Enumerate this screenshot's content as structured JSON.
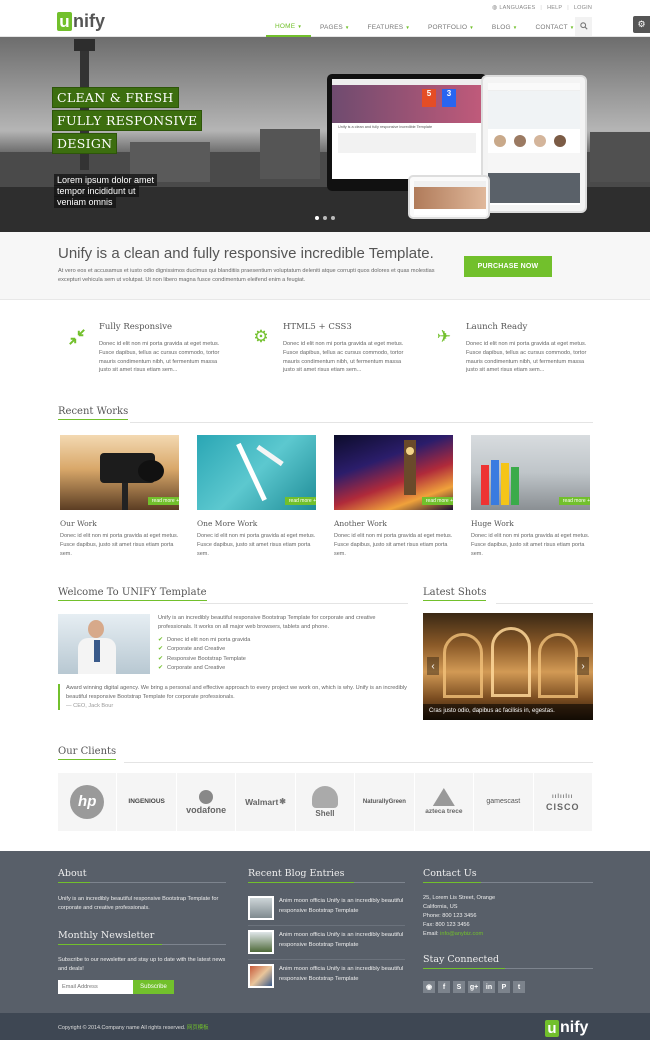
{
  "brand": {
    "logo_u": "u",
    "logo_rest": "nify",
    "accent": "#72c02c"
  },
  "topbar": {
    "languages": "LANGUAGES",
    "help": "HELP",
    "login": "LOGIN"
  },
  "nav": {
    "items": [
      {
        "label": "HOME"
      },
      {
        "label": "PAGES"
      },
      {
        "label": "FEATURES"
      },
      {
        "label": "PORTFOLIO"
      },
      {
        "label": "BLOG"
      },
      {
        "label": "CONTACT"
      }
    ],
    "active": "HOME"
  },
  "hero": {
    "captions": [
      "CLEAN & FRESH",
      "FULLY RESPONSIVE",
      "DESIGN"
    ],
    "sub": [
      "Lorem ipsum dolor amet",
      "tempor incididunt ut",
      "veniam omnis"
    ],
    "slides": 3,
    "active_slide": 1,
    "mock_title": "Unify is a clean and fully responsive incredible Template"
  },
  "purchase": {
    "title": "Unify is a clean and fully responsive incredible Template.",
    "text": "At vero eos et accusamus et iusto odio dignissimos ducimus qui blanditiis praesentium voluptatum deleniti atque corrupti quos dolores et quas molestias excepturi vehicula sem ut volutpat. Ut non libero magna fusce condimentum eleifend enim a feugiat.",
    "button": "PURCHASE NOW"
  },
  "features": [
    {
      "title": "Fully Responsive",
      "text": "Donec id elit non mi porta gravida at eget metus. Fusce dapibus, tellus ac cursus commodo, tortor mauris condimentum nibh, ut fermentum massa justo sit amet risus etiam sem..."
    },
    {
      "title": "HTML5 + CSS3",
      "text": "Donec id elit non mi porta gravida at eget metus. Fusce dapibus, tellus ac cursus commodo, tortor mauris condimentum nibh, ut fermentum massa justo sit amet risus etiam sem..."
    },
    {
      "title": "Launch Ready",
      "text": "Donec id elit non mi porta gravida at eget metus. Fusce dapibus, tellus ac cursus commodo, tortor mauris condimentum nibh, ut fermentum massa justo sit amet risus etiam sem..."
    }
  ],
  "recent_works": {
    "heading": "Recent Works",
    "read_more": "read more +",
    "items": [
      {
        "title": "Our Work",
        "text": "Donec id elit non mi porta gravida at eget metus. Fusce dapibus, justo sit amet risus etiam porta sem."
      },
      {
        "title": "One More Work",
        "text": "Donec id elit non mi porta gravida at eget metus. Fusce dapibus, justo sit amet risus etiam porta sem."
      },
      {
        "title": "Another Work",
        "text": "Donec id elit non mi porta gravida at eget metus. Fusce dapibus, justo sit amet risus etiam porta sem."
      },
      {
        "title": "Huge Work",
        "text": "Donec id elit non mi porta gravida at eget metus. Fusce dapibus, justo sit amet risus etiam porta sem."
      }
    ]
  },
  "welcome": {
    "heading": "Welcome To UNIFY Template",
    "text": "Unify is an incredibly beautiful responsive Bootstrap Template for corporate and creative professionals. It works on all major web browsers, tablets and phone.",
    "list": [
      "Donec id elit non mi porta gravida",
      "Corporate and Creative",
      "Responsive Bootstrap Template",
      "Corporate and Creative"
    ],
    "quote": "Award winning digital agency. We bring a personal and effective approach to every project we work on, which is why. Unify is an incredibly beautiful responsive Bootstrap Template for corporate professionals.",
    "author": "— CEO, Jack Bour"
  },
  "latest_shots": {
    "heading": "Latest Shots",
    "caption": "Cras justo odio, dapibus ac facilisis in, egestas."
  },
  "clients": {
    "heading": "Our Clients",
    "logos": [
      "hp",
      "INGENIOUS",
      "vodafone",
      "Walmart",
      "Shell",
      "NaturallyGreen",
      "azteca trece",
      "gamescast",
      "CISCO"
    ]
  },
  "footer": {
    "about": {
      "heading": "About",
      "text": "Unify is an incredibly beautiful responsive Bootstrap Template for corporate and creative professionals."
    },
    "newsletter": {
      "heading": "Monthly Newsletter",
      "text": "Subscribe to our newsletter and stay up to date with the latest news and deals!",
      "placeholder": "Email Address",
      "button": "Subscribe"
    },
    "blog": {
      "heading": "Recent Blog Entries",
      "items": [
        "Anim moon officia Unify is an incredibly beautiful responsive Bootstrap Template",
        "Anim moon officia Unify is an incredibly beautiful responsive Bootstrap Template",
        "Anim moon officia Unify is an incredibly beautiful responsive Bootstrap Template"
      ]
    },
    "contact": {
      "heading": "Contact Us",
      "lines": [
        "25, Lorem Lis Street, Orange",
        "California, US",
        "Phone: 800 123 3456",
        "Fax: 800 123 3456"
      ],
      "email_label": "Email:",
      "email": "info@anybiz.com"
    },
    "stay": {
      "heading": "Stay Connected",
      "icons": [
        "rss-icon",
        "facebook-icon",
        "skype-icon",
        "google-plus-icon",
        "linkedin-icon",
        "pinterest-icon",
        "twitter-icon",
        "vimeo-icon"
      ]
    },
    "copyright": "Copyright © 2014.Company name All rights reserved.",
    "copyright_link": "网页模板"
  }
}
